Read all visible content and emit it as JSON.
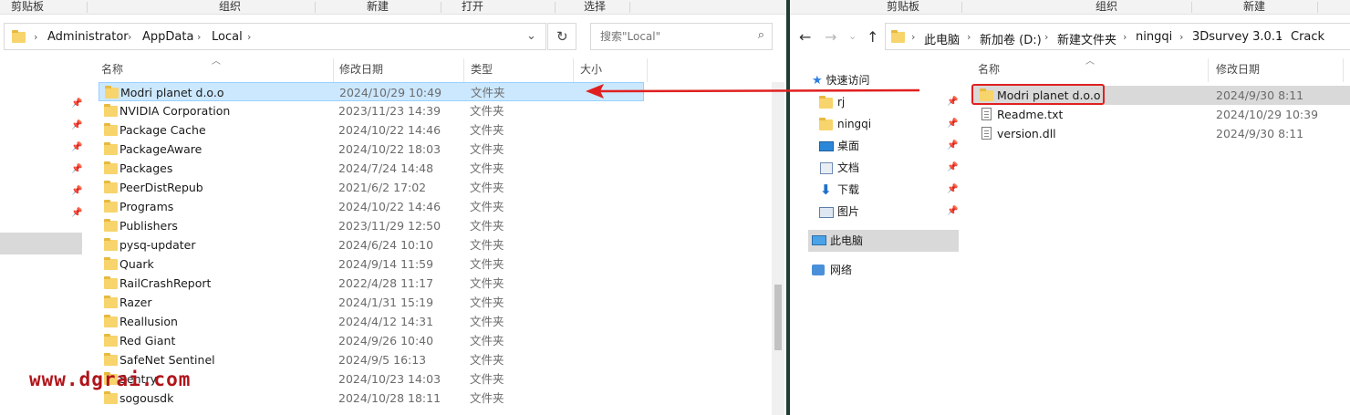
{
  "left": {
    "ribbon": {
      "clipboard": "剪贴板",
      "organize": "组织",
      "new": "新建",
      "open": "打开",
      "select": "选择"
    },
    "breadcrumb": [
      "Administrator",
      "AppData",
      "Local"
    ],
    "search_placeholder": "搜索\"Local\"",
    "columns": {
      "name": "名称",
      "date": "修改日期",
      "type": "类型",
      "size": "大小"
    },
    "rows": [
      {
        "name": "Modri planet d.o.o",
        "date": "2024/10/29 10:49",
        "type": "文件夹"
      },
      {
        "name": "NVIDIA Corporation",
        "date": "2023/11/23 14:39",
        "type": "文件夹"
      },
      {
        "name": "Package Cache",
        "date": "2024/10/22 14:46",
        "type": "文件夹"
      },
      {
        "name": "PackageAware",
        "date": "2024/10/22 18:03",
        "type": "文件夹"
      },
      {
        "name": "Packages",
        "date": "2024/7/24 14:48",
        "type": "文件夹"
      },
      {
        "name": "PeerDistRepub",
        "date": "2021/6/2 17:02",
        "type": "文件夹"
      },
      {
        "name": "Programs",
        "date": "2024/10/22 14:46",
        "type": "文件夹"
      },
      {
        "name": "Publishers",
        "date": "2023/11/29 12:50",
        "type": "文件夹"
      },
      {
        "name": "pysq-updater",
        "date": "2024/6/24 10:10",
        "type": "文件夹"
      },
      {
        "name": "Quark",
        "date": "2024/9/14 11:59",
        "type": "文件夹"
      },
      {
        "name": "RailCrashReport",
        "date": "2022/4/28 11:17",
        "type": "文件夹"
      },
      {
        "name": "Razer",
        "date": "2024/1/31 15:19",
        "type": "文件夹"
      },
      {
        "name": "Reallusion",
        "date": "2024/4/12 14:31",
        "type": "文件夹"
      },
      {
        "name": "Red Giant",
        "date": "2024/9/26 10:40",
        "type": "文件夹"
      },
      {
        "name": "SafeNet Sentinel",
        "date": "2024/9/5 16:13",
        "type": "文件夹"
      },
      {
        "name": "Sentry",
        "date": "2024/10/23 14:03",
        "type": "文件夹"
      },
      {
        "name": "sogousdk",
        "date": "2024/10/28 18:11",
        "type": "文件夹"
      }
    ]
  },
  "right": {
    "ribbon": {
      "clipboard": "剪贴板",
      "organize": "组织",
      "new": "新建"
    },
    "breadcrumb": [
      "此电脑",
      "新加卷 (D:)",
      "新建文件夹",
      "ningqi",
      "3Dsurvey 3.0.1",
      "Crack"
    ],
    "columns": {
      "name": "名称",
      "date": "修改日期"
    },
    "nav": {
      "quick_access": "快速访问",
      "items": [
        "rj",
        "ningqi",
        "桌面",
        "文档",
        "下载",
        "图片"
      ],
      "this_pc": "此电脑",
      "network": "网络"
    },
    "rows": [
      {
        "name": "Modri planet d.o.o",
        "date": "2024/9/30 8:11",
        "kind": "folder"
      },
      {
        "name": "Readme.txt",
        "date": "2024/10/29 10:39",
        "kind": "file"
      },
      {
        "name": "version.dll",
        "date": "2024/9/30 8:11",
        "kind": "file"
      }
    ]
  },
  "watermark": "www.dgrai.com",
  "colors": {
    "selection": "#cce8ff",
    "highlight_box": "#e02020",
    "arrow": "#e02020",
    "watermark": "#b0141b"
  }
}
